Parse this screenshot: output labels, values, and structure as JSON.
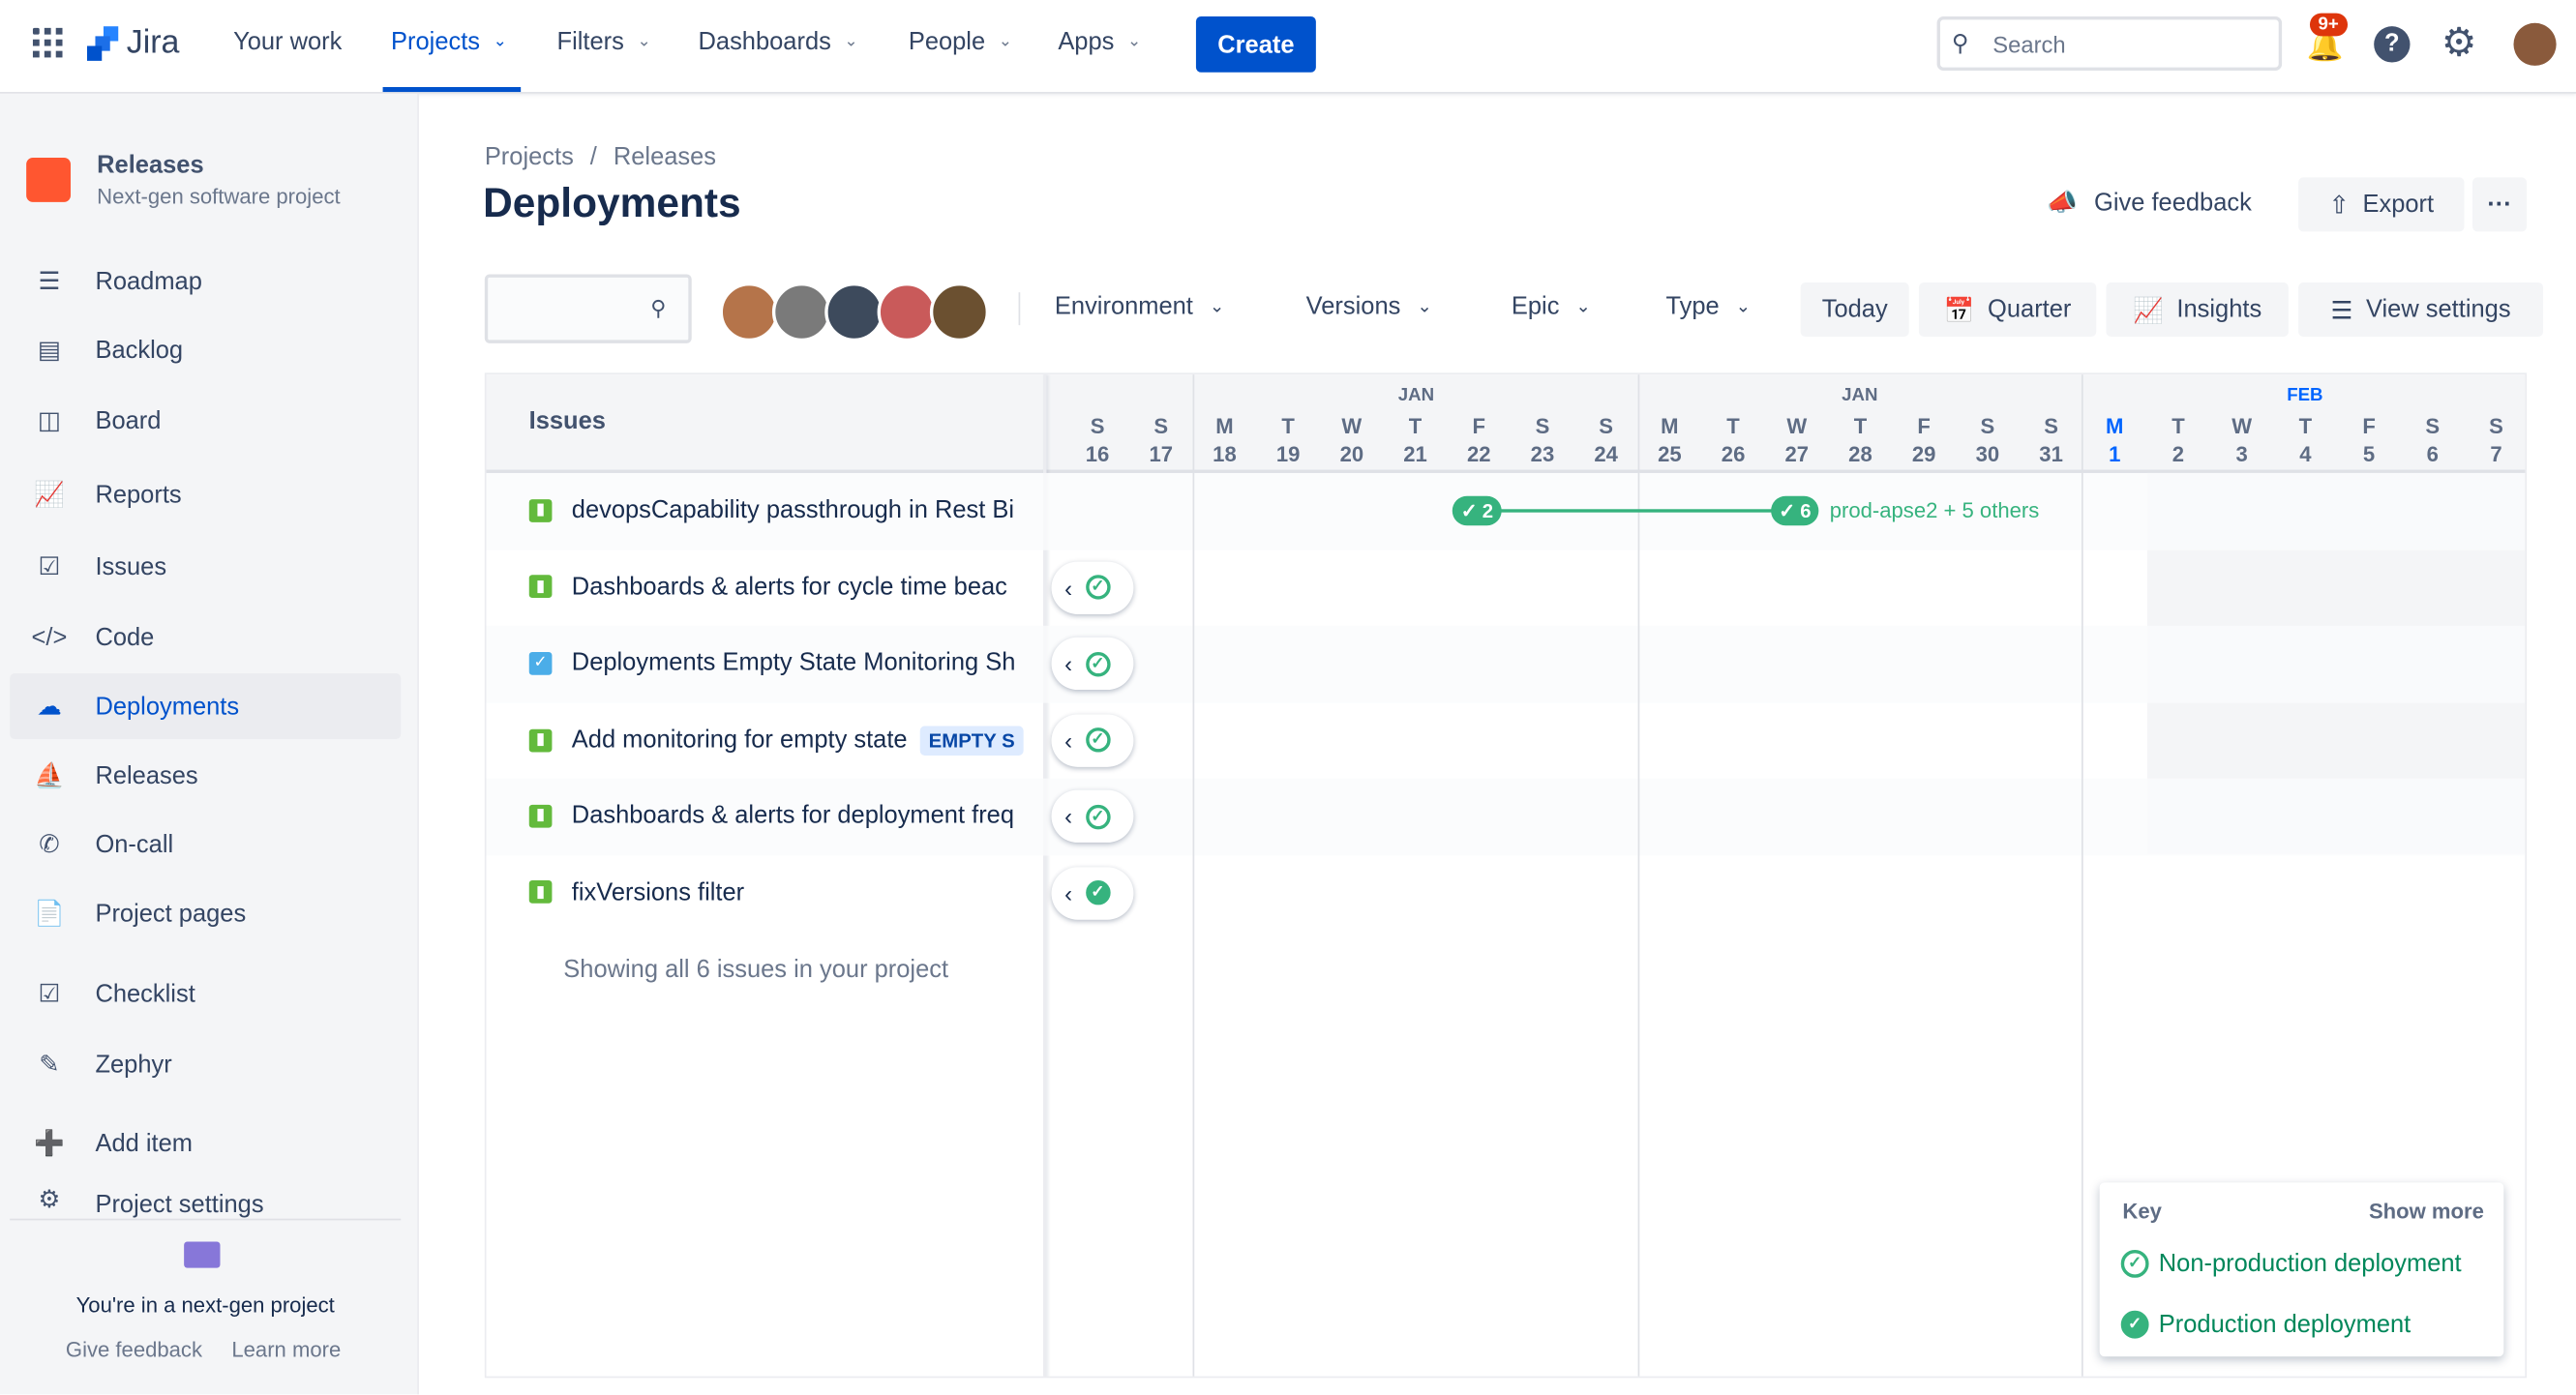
{
  "topnav": {
    "product": "Jira",
    "items": [
      {
        "label": "Your work",
        "dropdown": false
      },
      {
        "label": "Projects",
        "dropdown": true,
        "active": true
      },
      {
        "label": "Filters",
        "dropdown": true
      },
      {
        "label": "Dashboards",
        "dropdown": true
      },
      {
        "label": "People",
        "dropdown": true
      },
      {
        "label": "Apps",
        "dropdown": true
      }
    ],
    "create": "Create",
    "search_placeholder": "Search",
    "notification_badge": "9+",
    "accent": "#0052cc"
  },
  "sidebar": {
    "project_name": "Releases",
    "project_type": "Next-gen software project",
    "items": [
      {
        "label": "Roadmap",
        "icon": "roadmap-icon"
      },
      {
        "label": "Backlog",
        "icon": "backlog-icon"
      },
      {
        "label": "Board",
        "icon": "board-icon"
      },
      {
        "label": "Reports",
        "icon": "reports-icon"
      },
      {
        "label": "Issues",
        "icon": "issues-icon"
      },
      {
        "label": "Code",
        "icon": "code-icon"
      },
      {
        "label": "Deployments",
        "icon": "deployments-icon",
        "selected": true
      },
      {
        "label": "Releases",
        "icon": "releases-icon"
      },
      {
        "label": "On-call",
        "icon": "on-call-icon"
      },
      {
        "label": "Project pages",
        "icon": "pages-icon"
      },
      {
        "label": "Checklist",
        "icon": "checklist-icon"
      },
      {
        "label": "Zephyr",
        "icon": "zephyr-icon"
      },
      {
        "label": "Add item",
        "icon": "add-item-icon"
      },
      {
        "label": "Project settings",
        "icon": "settings-icon"
      }
    ],
    "footer_text": "You're in a next-gen project",
    "footer_feedback": "Give feedback",
    "footer_learn": "Learn more"
  },
  "page": {
    "breadcrumb": [
      "Projects",
      "Releases"
    ],
    "title": "Deployments",
    "give_feedback": "Give feedback",
    "export": "Export"
  },
  "toolbar": {
    "filters": [
      "Environment",
      "Versions",
      "Epic",
      "Type"
    ],
    "today": "Today",
    "quarter": "Quarter",
    "insights": "Insights",
    "view_settings": "View settings"
  },
  "timeline": {
    "issues_header": "Issues",
    "months": [
      {
        "label": "JAN"
      },
      {
        "label": "JAN"
      },
      {
        "label": "FEB",
        "current": true
      }
    ],
    "days": [
      {
        "d": "S",
        "n": "16"
      },
      {
        "d": "S",
        "n": "17"
      },
      {
        "d": "M",
        "n": "18"
      },
      {
        "d": "T",
        "n": "19"
      },
      {
        "d": "W",
        "n": "20"
      },
      {
        "d": "T",
        "n": "21"
      },
      {
        "d": "F",
        "n": "22"
      },
      {
        "d": "S",
        "n": "23"
      },
      {
        "d": "S",
        "n": "24"
      },
      {
        "d": "M",
        "n": "25"
      },
      {
        "d": "T",
        "n": "26"
      },
      {
        "d": "W",
        "n": "27"
      },
      {
        "d": "T",
        "n": "28"
      },
      {
        "d": "F",
        "n": "29"
      },
      {
        "d": "S",
        "n": "30"
      },
      {
        "d": "S",
        "n": "31"
      },
      {
        "d": "M",
        "n": "1",
        "today": true
      },
      {
        "d": "T",
        "n": "2"
      },
      {
        "d": "W",
        "n": "3"
      },
      {
        "d": "T",
        "n": "4"
      },
      {
        "d": "F",
        "n": "5"
      },
      {
        "d": "S",
        "n": "6"
      },
      {
        "d": "S",
        "n": "7"
      }
    ],
    "issues": [
      {
        "title": "devopsCapability passthrough in Rest Bi",
        "type": "story"
      },
      {
        "title": "Dashboards & alerts for cycle time beac",
        "type": "story",
        "prod": false
      },
      {
        "title": "Deployments Empty State Monitoring Sh",
        "type": "task",
        "prod": false
      },
      {
        "title": "Add monitoring for empty state",
        "type": "story",
        "label": "EMPTY S",
        "prod": false
      },
      {
        "title": "Dashboards & alerts for deployment freq",
        "type": "story",
        "prod": false
      },
      {
        "title": "fixVersions filter",
        "type": "story",
        "prod": true
      }
    ],
    "deployments": {
      "first_count": "2",
      "second_count": "6",
      "second_label": "prod-apse2 + 5 others"
    },
    "footer": "Showing all 6 issues in your project"
  },
  "key": {
    "title": "Key",
    "show_more": "Show more",
    "non_production": "Non-production deployment",
    "production": "Production deployment",
    "color": "#36b37e"
  }
}
